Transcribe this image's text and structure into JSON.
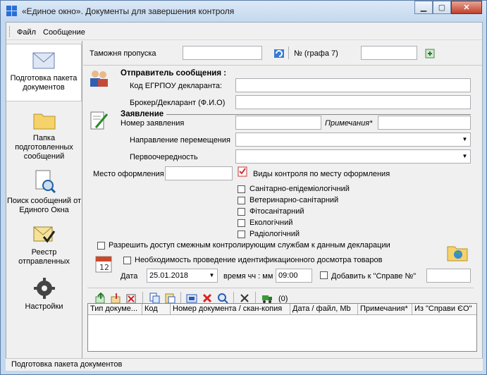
{
  "window": {
    "title": "«Единое окно». Документы для завершения контроля"
  },
  "menu": {
    "file": "Файл",
    "message": "Сообщение"
  },
  "sidebar": {
    "items": [
      {
        "label": "Подготовка пакета документов",
        "icon": "envelope-icon"
      },
      {
        "label": "Папка подготовленных сообщений",
        "icon": "folder-icon"
      },
      {
        "label": "Поиск сообщений от Единого Окна",
        "icon": "document-search-icon"
      },
      {
        "label": "Реестр отправленных",
        "icon": "envelope-check-icon"
      },
      {
        "label": "Настройки",
        "icon": "gear-icon"
      }
    ]
  },
  "top": {
    "customs_label": "Таможня пропуска",
    "customs_value": "",
    "num_label": "№ (графа 7)",
    "num_value": ""
  },
  "sender": {
    "heading": "Отправитель сообщения :",
    "edrpou_label": "Код ЕГРПОУ декларанта:",
    "edrpou_value": "",
    "broker_label": "Брокер/Декларант (Ф.И.О)",
    "broker_value": ""
  },
  "statement": {
    "heading": "Заявление",
    "number_label": "Номер заявления",
    "number_value": "",
    "notes_label": "Примечания*",
    "notes_value": "",
    "direction_label": "Направление перемещения",
    "direction_value": "",
    "priority_label": "Первоочередность",
    "priority_value": ""
  },
  "place": {
    "label": "Место оформления",
    "value": "",
    "control_types_label": "Виды контроля по месту оформления"
  },
  "controls": [
    "Санітарно-епідеміологічний",
    "Ветеринарно-санітарний",
    "Фітосанітарний",
    "Екологічний",
    "Радіологічний"
  ],
  "access": {
    "label": "Разрешить доступ смежным контролирующим службам к данным декларации"
  },
  "inspection": {
    "label": "Необходимость проведение идентификационного досмотра товаров"
  },
  "date": {
    "label": "Дата",
    "value": "25.01.2018",
    "time_label": "время чч : мм",
    "time_value": "09:00",
    "add_ref_label": "Добавить к \"Справе №\"",
    "add_ref_value": ""
  },
  "docs": {
    "count": "(0)",
    "columns": [
      "Тип докуме...",
      "Код",
      "Номер документа / скан-копия",
      "Дата / файл, Mb",
      "Примечания*",
      "Из \"Справи ЄО\""
    ]
  },
  "status": {
    "text": "Подготовка пакета документов"
  }
}
